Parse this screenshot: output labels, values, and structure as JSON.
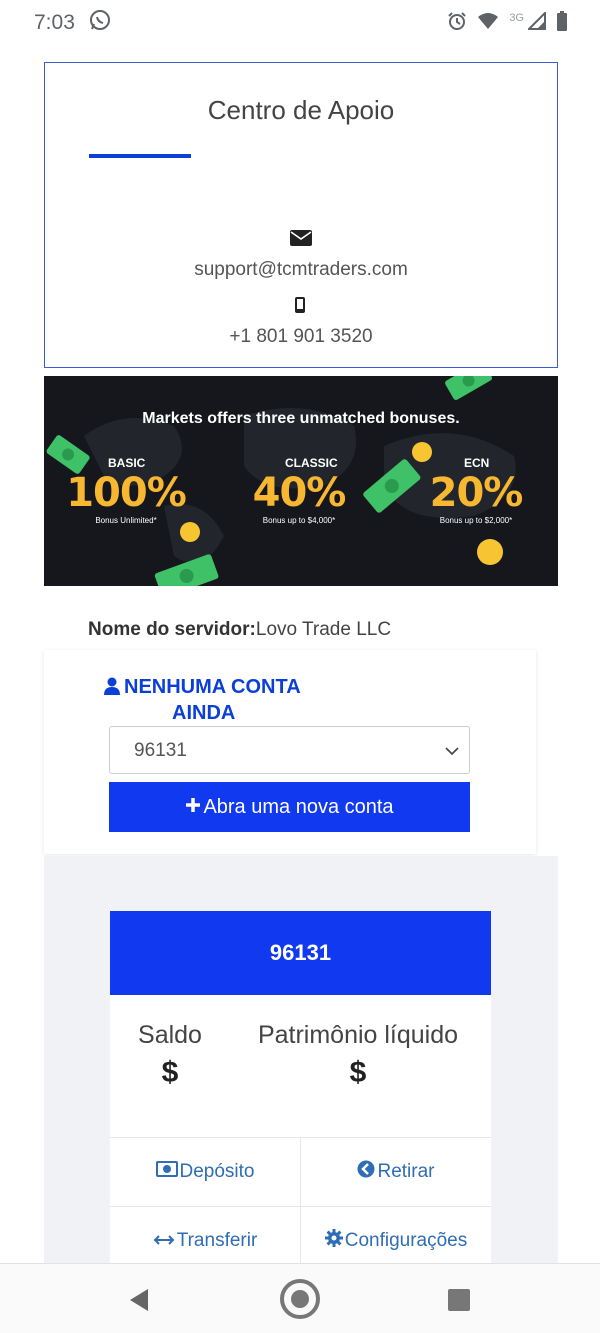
{
  "status_bar": {
    "time": "7:03",
    "network": "3G"
  },
  "support": {
    "title": "Centro de Apoio",
    "email": "support@tcmtraders.com",
    "phone": "+1 801 901 3520"
  },
  "banner": {
    "headline": "Markets offers three unmatched bonuses.",
    "bonuses": [
      {
        "name": "BASIC",
        "percent": "100%",
        "note": "Bonus Unlimited*"
      },
      {
        "name": "CLASSIC",
        "percent": "40%",
        "note": "Bonus up to $4,000*"
      },
      {
        "name": "ECN",
        "percent": "20%",
        "note": "Bonus up to $2,000*"
      }
    ]
  },
  "server": {
    "label": "Nome do servidor:",
    "value": "Lovo Trade LLC"
  },
  "account_panel": {
    "no_account_line1": "NENHUMA CONTA",
    "no_account_line2": "AINDA",
    "selected_account": "96131",
    "open_account_label": "Abra uma nova conta"
  },
  "account_card": {
    "number": "96131",
    "balance_label": "Saldo",
    "balance_value": "$",
    "equity_label": "Patrimônio líquido",
    "equity_value": "$",
    "actions": {
      "deposit": "Depósito",
      "withdraw": "Retirar",
      "transfer": "Transferir",
      "settings": "Configurações"
    }
  },
  "colors": {
    "primary": "#1139ef",
    "link": "#2f6db5",
    "bonus": "#f7b731"
  },
  "icons": [
    "whatsapp-icon",
    "alarm-icon",
    "wifi-icon",
    "signal-icon",
    "battery-icon",
    "mail-icon",
    "phone-icon",
    "user-icon",
    "chevron-down-icon",
    "plus-icon",
    "money-icon",
    "arrow-left-circle-icon",
    "swap-icon",
    "gear-icon",
    "back-icon",
    "home-icon",
    "recent-apps-icon"
  ]
}
